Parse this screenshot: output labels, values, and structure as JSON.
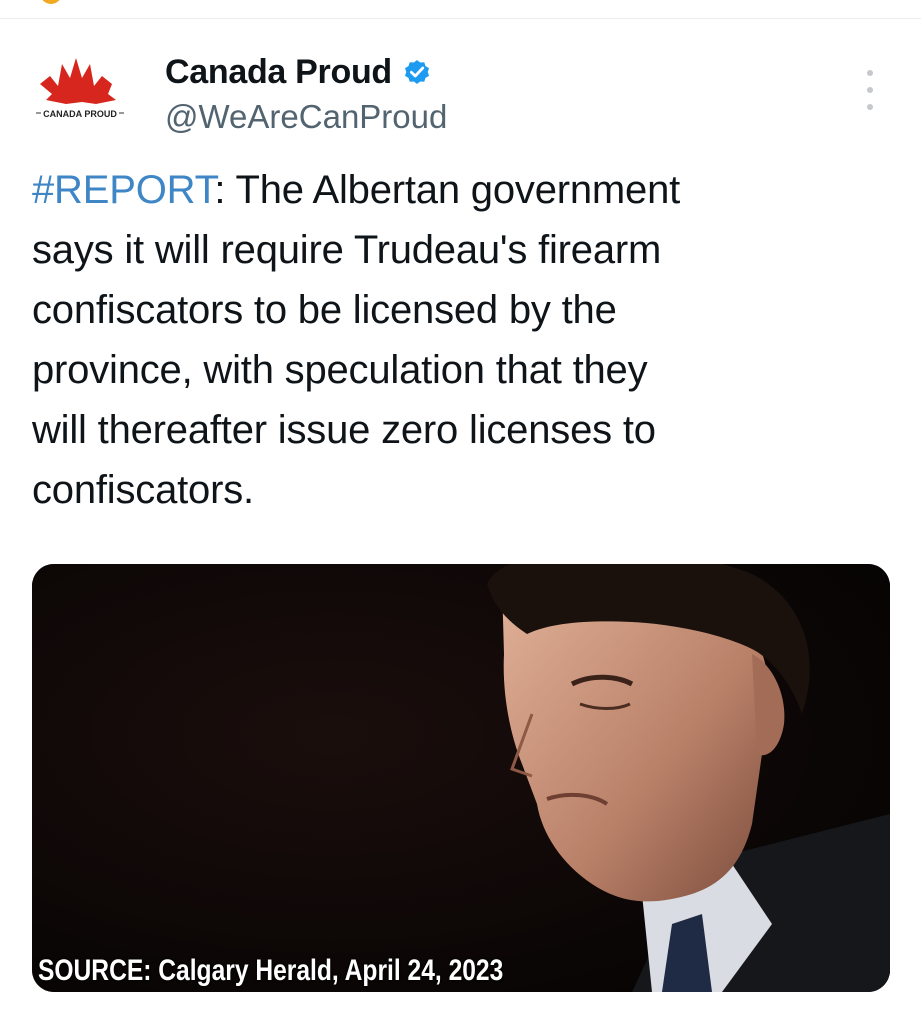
{
  "tweet": {
    "author": {
      "display_name": "Canada Proud",
      "handle": "@WeAreCanProud",
      "avatar_text": "CANADA PROUD",
      "avatar_icon": "maple-leaf-logo",
      "verified": true,
      "verified_icon": "verified-badge-icon"
    },
    "text": {
      "hashtag": "#REPORT",
      "line1_rest": ": The Albertan government",
      "line2": "says it will require Trudeau's firearm",
      "line3": "confiscators to be licensed by the",
      "line4": "province, with speculation that they",
      "line5": "will thereafter issue zero licenses to",
      "line6": "confiscators."
    },
    "media": {
      "caption": "SOURCE: Calgary Herald, April 24, 2023"
    },
    "more_icon": "more-options-icon"
  },
  "colors": {
    "hashtag": "#3f86c6",
    "verified": "#1d9bf0",
    "handle": "#536471",
    "text": "#0f1419",
    "logo_red": "#d7261e"
  }
}
